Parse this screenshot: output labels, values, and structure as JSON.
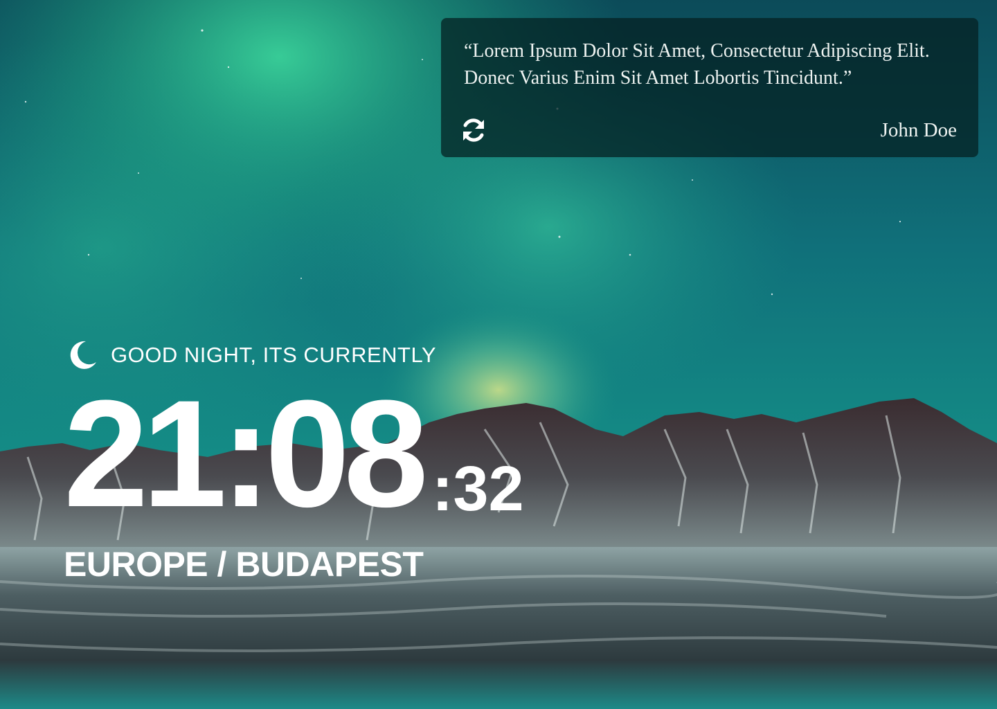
{
  "background": {
    "description_icon": "aurora-mountain-lake-background",
    "colors": {
      "sky_top": "#0b3f4f",
      "sky_mid": "#138a7d",
      "aurora": "#35d79a",
      "mountain_dark": "#2c2528",
      "snow": "#c8d6d4"
    }
  },
  "quote": {
    "text": "“Lorem Ipsum Dolor Sit Amet, Consectetur Adipiscing Elit. Donec Varius Enim Sit Amet Lobortis Tincidunt.”",
    "author": "John Doe",
    "refresh_icon": "refresh-icon"
  },
  "greeting": {
    "icon": "moon-icon",
    "text": "GOOD NIGHT, ITS CURRENTLY"
  },
  "clock": {
    "time": "21:08",
    "seconds": ":32"
  },
  "location": {
    "text": "EUROPE / BUDAPEST"
  }
}
